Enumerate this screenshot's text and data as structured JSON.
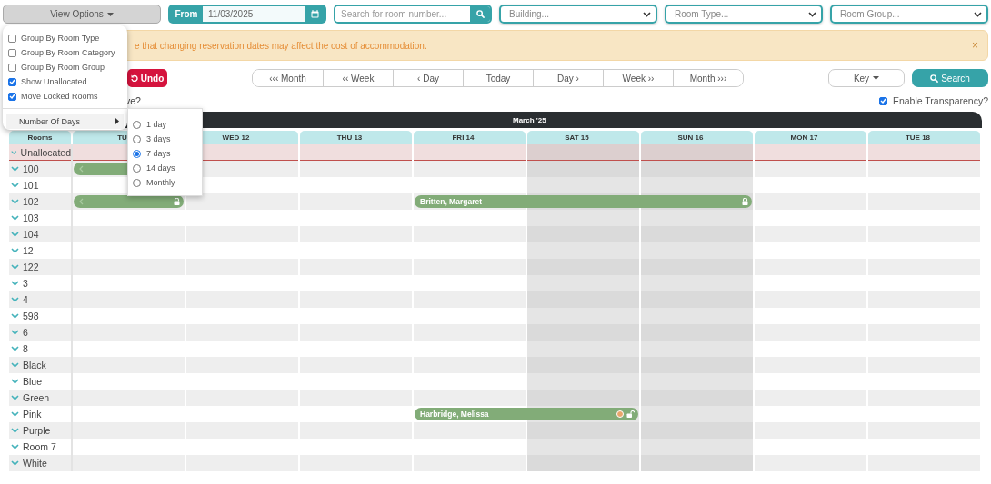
{
  "toolbar": {
    "view_options": "View Options",
    "from_label": "From",
    "date": "11/03/2025",
    "search_placeholder": "Search for room number...",
    "selects": [
      "Building...",
      "Room Type...",
      "Room Group..."
    ]
  },
  "alert": {
    "text": "e that changing reservation dates may affect the cost of accommodation.",
    "close": "×"
  },
  "actions": {
    "undo": "Undo",
    "nav": [
      "‹‹‹ Month",
      "‹‹ Week",
      "‹ Day",
      "Today",
      "Day ›",
      "Week ››",
      "Month ›››"
    ],
    "key": "Key",
    "search": "Search"
  },
  "prompt_fragment": "ve?",
  "transparency": {
    "label": "Enable Transparency?",
    "checked": true
  },
  "calendar": {
    "month": "March '25",
    "rooms_heading": "Rooms",
    "days": [
      {
        "label": "TU",
        "weekend": false
      },
      {
        "label": "WED 12",
        "weekend": false
      },
      {
        "label": "THU 13",
        "weekend": false
      },
      {
        "label": "FRI 14",
        "weekend": false
      },
      {
        "label": "SAT 15",
        "weekend": true
      },
      {
        "label": "SUN 16",
        "weekend": true
      },
      {
        "label": "MON 17",
        "weekend": false
      },
      {
        "label": "TUE 18",
        "weekend": false
      }
    ],
    "rooms": [
      {
        "name": "Unallocated",
        "kind": "unallocated"
      },
      {
        "name": "100",
        "kind": "room",
        "bookings": [
          {
            "nights": [
              true,
              false,
              false,
              false,
              false,
              false,
              false,
              false
            ],
            "continues_before": true
          }
        ]
      },
      {
        "name": "101",
        "kind": "room"
      },
      {
        "name": "102",
        "kind": "room",
        "bookings": [
          {
            "nights": [
              true,
              false,
              false,
              false,
              false,
              false,
              false,
              false
            ],
            "continues_before": true,
            "locked": true
          },
          {
            "guest": "Britten, Margaret",
            "nights": [
              false,
              false,
              false,
              true,
              true,
              true,
              false,
              false
            ],
            "continues_before": false,
            "locked": true
          }
        ]
      },
      {
        "name": "103",
        "kind": "room"
      },
      {
        "name": "104",
        "kind": "room"
      },
      {
        "name": "12",
        "kind": "room"
      },
      {
        "name": "122",
        "kind": "room"
      },
      {
        "name": "3",
        "kind": "room"
      },
      {
        "name": "4",
        "kind": "room"
      },
      {
        "name": "598",
        "kind": "room"
      },
      {
        "name": "6",
        "kind": "room"
      },
      {
        "name": "8",
        "kind": "room"
      },
      {
        "name": "Black",
        "kind": "room"
      },
      {
        "name": "Blue",
        "kind": "room"
      },
      {
        "name": "Green",
        "kind": "room"
      },
      {
        "name": "Pink",
        "kind": "room",
        "bookings": [
          {
            "guest": "Harbridge, Melissa",
            "nights": [
              false,
              false,
              false,
              true,
              true,
              false,
              false,
              false
            ],
            "continues_before": false,
            "locked": false,
            "color": "#e9a66b"
          }
        ]
      },
      {
        "name": "Purple",
        "kind": "room"
      },
      {
        "name": "Room 7",
        "kind": "room"
      },
      {
        "name": "White",
        "kind": "room"
      }
    ]
  },
  "view_menu": {
    "options": [
      {
        "label": "Group By Room Type",
        "checked": false
      },
      {
        "label": "Group By Room Category",
        "checked": false
      },
      {
        "label": "Group By Room Group",
        "checked": false
      },
      {
        "label": "Show Unallocated",
        "checked": true
      },
      {
        "label": "Move Locked Rooms",
        "checked": true
      }
    ],
    "submenu": {
      "label": "Number Of Days",
      "expanded": true,
      "options": [
        {
          "label": "1 day",
          "selected": false
        },
        {
          "label": "3 days",
          "selected": false
        },
        {
          "label": "7 days",
          "selected": true
        },
        {
          "label": "14 days",
          "selected": false
        },
        {
          "label": "Monthly",
          "selected": false
        }
      ]
    }
  }
}
